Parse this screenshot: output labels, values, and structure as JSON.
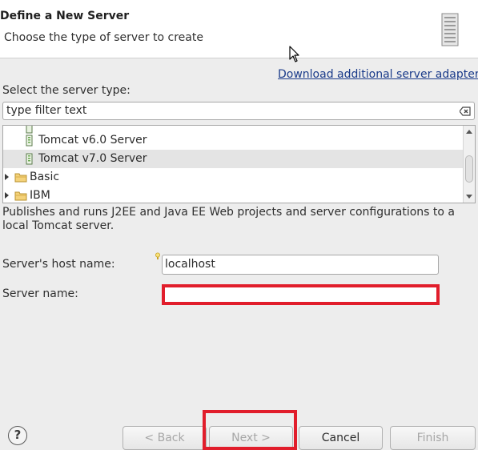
{
  "header": {
    "title": "Define a New Server",
    "description": "Choose the type of server to create",
    "icon": "server-icon"
  },
  "download_link": "Download additional server adapters",
  "server_type_label": "Select the server type:",
  "filter": {
    "placeholder": "type filter text",
    "value": "type filter text",
    "clear_icon": "clear-filter-icon"
  },
  "tree": {
    "items": [
      {
        "label": "Tomcat v6.0 Server",
        "icon": "server-adapter-icon",
        "selected": false
      },
      {
        "label": "Tomcat v7.0 Server",
        "icon": "server-adapter-icon",
        "selected": true
      },
      {
        "label": "Basic",
        "icon": "folder-icon",
        "selected": false
      },
      {
        "label": "IBM",
        "icon": "folder-icon",
        "selected": false
      }
    ]
  },
  "description": "Publishes and runs J2EE and Java EE Web projects and server configurations to a local Tomcat server.",
  "host": {
    "label": "Server's host name:",
    "value": "localhost"
  },
  "server_name": {
    "label": "Server name:",
    "value": ""
  },
  "buttons": {
    "help": "?",
    "back": "< Back",
    "next": "Next >",
    "cancel": "Cancel",
    "finish": "Finish"
  },
  "colors": {
    "highlight": "#e11d2b",
    "link": "#1a3b8a",
    "selected_row": "#e4e4e4"
  }
}
